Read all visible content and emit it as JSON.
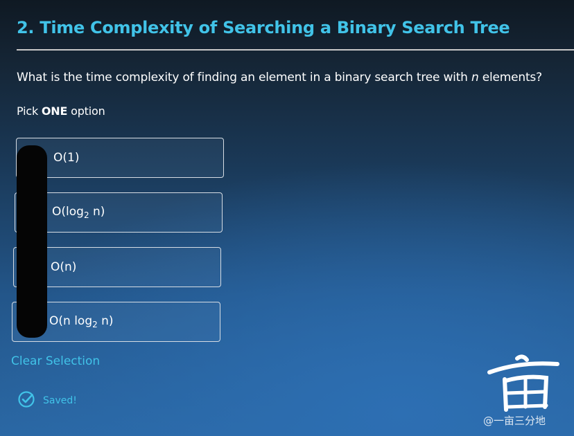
{
  "question": {
    "title": "2. Time Complexity of Searching a Binary Search Tree",
    "prompt_before": "What is the time complexity of finding an element in a binary search tree with ",
    "prompt_var": "n",
    "prompt_after": " elements?",
    "pick_prefix": "Pick ",
    "pick_bold": "ONE",
    "pick_suffix": " option"
  },
  "options": [
    {
      "pre": "O(1)",
      "sub": "",
      "post": ""
    },
    {
      "pre": "O(log",
      "sub": "2",
      "post": " n)"
    },
    {
      "pre": "O(n)",
      "sub": "",
      "post": ""
    },
    {
      "pre": "O(n log",
      "sub": "2",
      "post": " n)"
    }
  ],
  "actions": {
    "clear_label": "Clear Selection"
  },
  "status": {
    "saved_label": "Saved!"
  },
  "watermark": {
    "text": "@一亩三分地",
    "logo_text": "亩"
  },
  "colors": {
    "accent": "#41c3e8",
    "text": "#ffffff",
    "option_border": "#d7dde4"
  }
}
